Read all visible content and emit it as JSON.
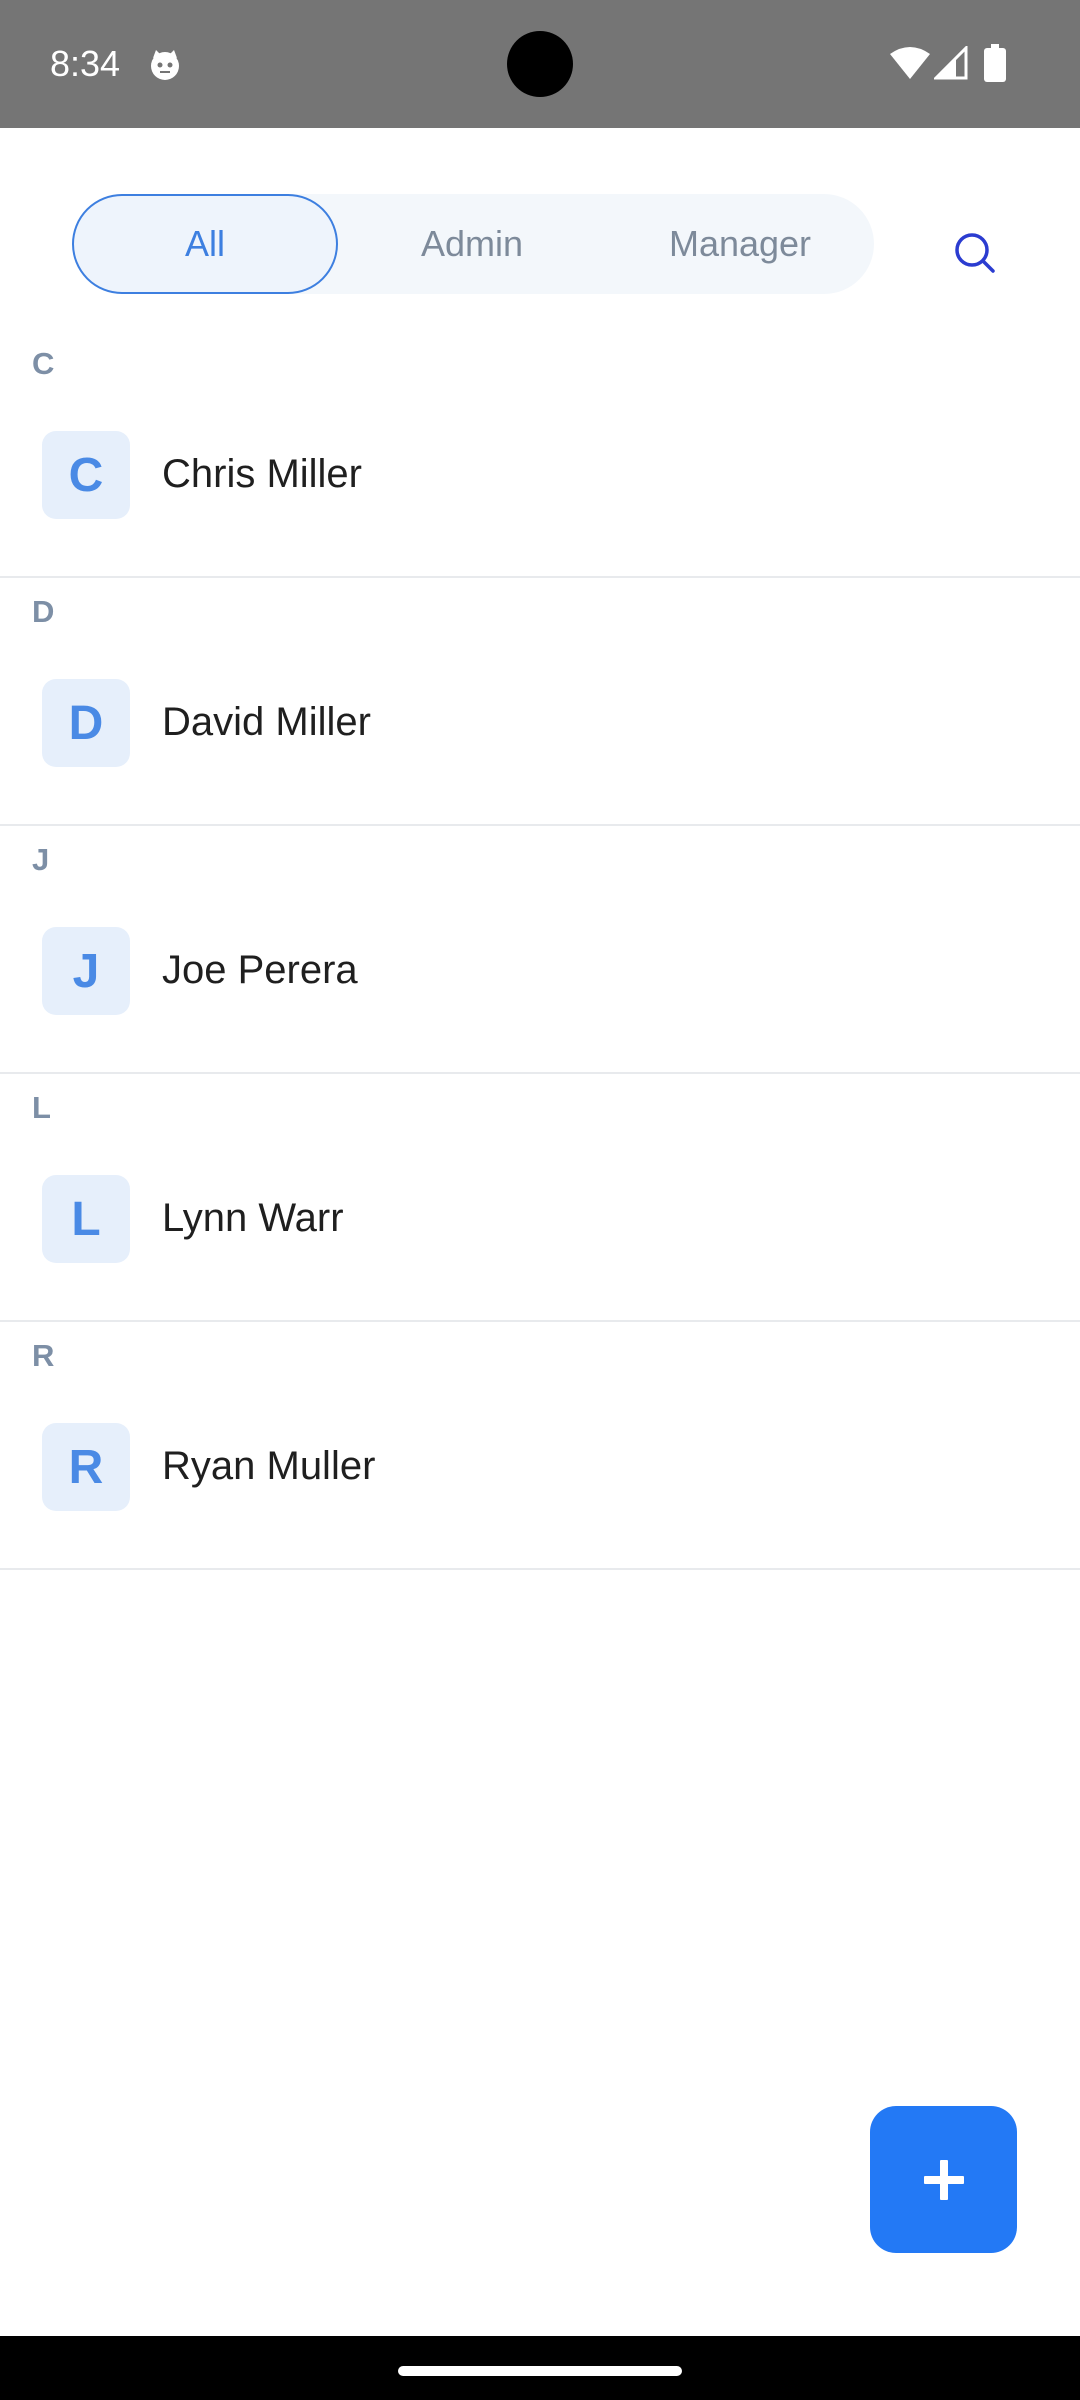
{
  "status_bar": {
    "time": "8:34",
    "icons": [
      "cat-notification-icon",
      "wifi-icon",
      "signal-icon",
      "battery-icon"
    ]
  },
  "filter_tabs": {
    "items": [
      {
        "label": "All",
        "selected": true
      },
      {
        "label": "Admin",
        "selected": false
      },
      {
        "label": "Manager",
        "selected": false
      }
    ]
  },
  "search": {
    "icon": "search-icon"
  },
  "contacts": {
    "sections": [
      {
        "letter": "C",
        "initial": "C",
        "name": "Chris Miller"
      },
      {
        "letter": "D",
        "initial": "D",
        "name": "David Miller"
      },
      {
        "letter": "J",
        "initial": "J",
        "name": "Joe Perera"
      },
      {
        "letter": "L",
        "initial": "L",
        "name": "Lynn Warr"
      },
      {
        "letter": "R",
        "initial": "R",
        "name": "Ryan Muller"
      }
    ]
  },
  "fab": {
    "icon": "plus-icon"
  },
  "colors": {
    "accent": "#2379f5",
    "tab_selected": "#3d7fe0",
    "avatar_bg": "#e6effb",
    "avatar_text": "#4a8ae5",
    "section_letter": "#7d8fa6",
    "status_bar": "#757575"
  }
}
